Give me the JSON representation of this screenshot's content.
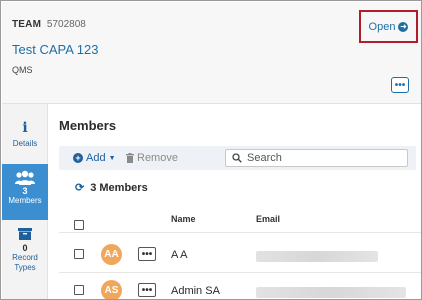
{
  "header": {
    "team_label": "TEAM",
    "team_id": "5702808",
    "title": "Test CAPA 123",
    "subtitle": "QMS",
    "open_label": "Open",
    "more_label": "•••"
  },
  "sidebar": {
    "items": [
      {
        "label": "Details",
        "icon": "info-icon"
      },
      {
        "count": "3",
        "label": "Members",
        "icon": "people-icon",
        "active": true
      },
      {
        "count": "0",
        "label": "Record Types",
        "icon": "box-icon"
      }
    ]
  },
  "main": {
    "title": "Members",
    "add_label": "Add",
    "remove_label": "Remove",
    "search_placeholder": "Search",
    "member_count_label": "3 Members",
    "columns": {
      "name": "Name",
      "email": "Email"
    },
    "rows": [
      {
        "initials": "AA",
        "name": "A A",
        "more": "•••"
      },
      {
        "initials": "AS",
        "name": "Admin SA",
        "more": "•••"
      }
    ]
  },
  "colors": {
    "accent": "#1f6fa6",
    "highlight_border": "#b01e2c",
    "sidebar_active": "#3b8fd0",
    "avatar": "#f0a75c"
  }
}
